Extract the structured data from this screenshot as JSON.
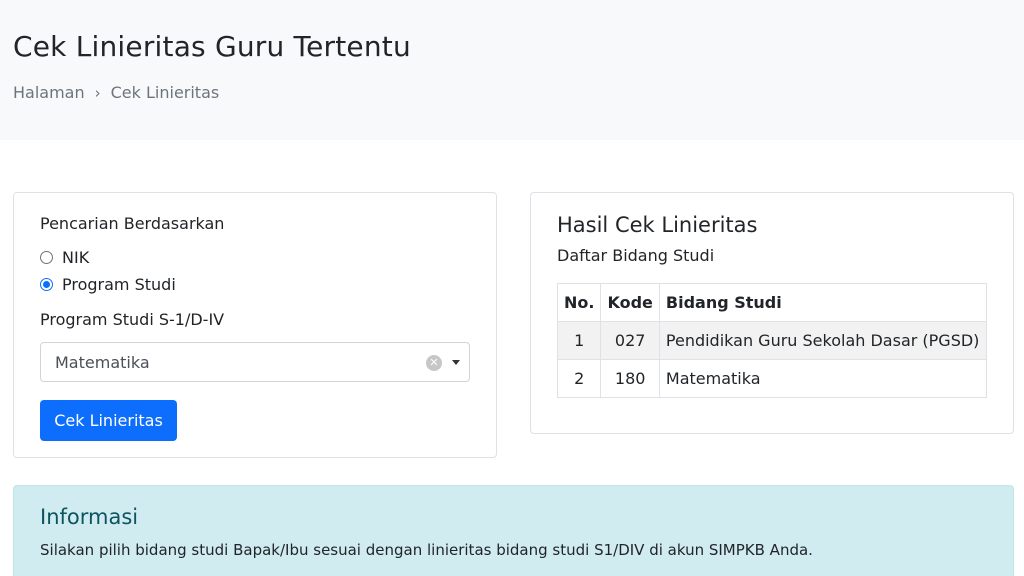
{
  "header": {
    "title": "Cek Linieritas Guru Tertentu",
    "breadcrumb": [
      "Halaman",
      "Cek Linieritas"
    ]
  },
  "search_card": {
    "search_by_label": "Pencarian Berdasarkan",
    "radio_options": [
      {
        "label": "NIK",
        "checked": false
      },
      {
        "label": "Program Studi",
        "checked": true
      }
    ],
    "program_label": "Program Studi S-1/D-IV",
    "program_value": "Matematika",
    "submit_label": "Cek Linieritas"
  },
  "result_card": {
    "title": "Hasil Cek Linieritas",
    "subtitle": "Daftar Bidang Studi",
    "columns": [
      "No.",
      "Kode",
      "Bidang Studi"
    ],
    "rows": [
      {
        "no": "1",
        "kode": "027",
        "bidang": "Pendidikan Guru Sekolah Dasar (PGSD)"
      },
      {
        "no": "2",
        "kode": "180",
        "bidang": "Matematika"
      }
    ]
  },
  "info": {
    "title": "Informasi",
    "text": "Silakan pilih bidang studi Bapak/Ibu sesuai dengan linieritas bidang studi S1/DIV di akun SIMPKB Anda."
  },
  "colors": {
    "primary": "#0d6efd",
    "info_bg": "#d1ecf1",
    "info_title": "#0c5460"
  }
}
